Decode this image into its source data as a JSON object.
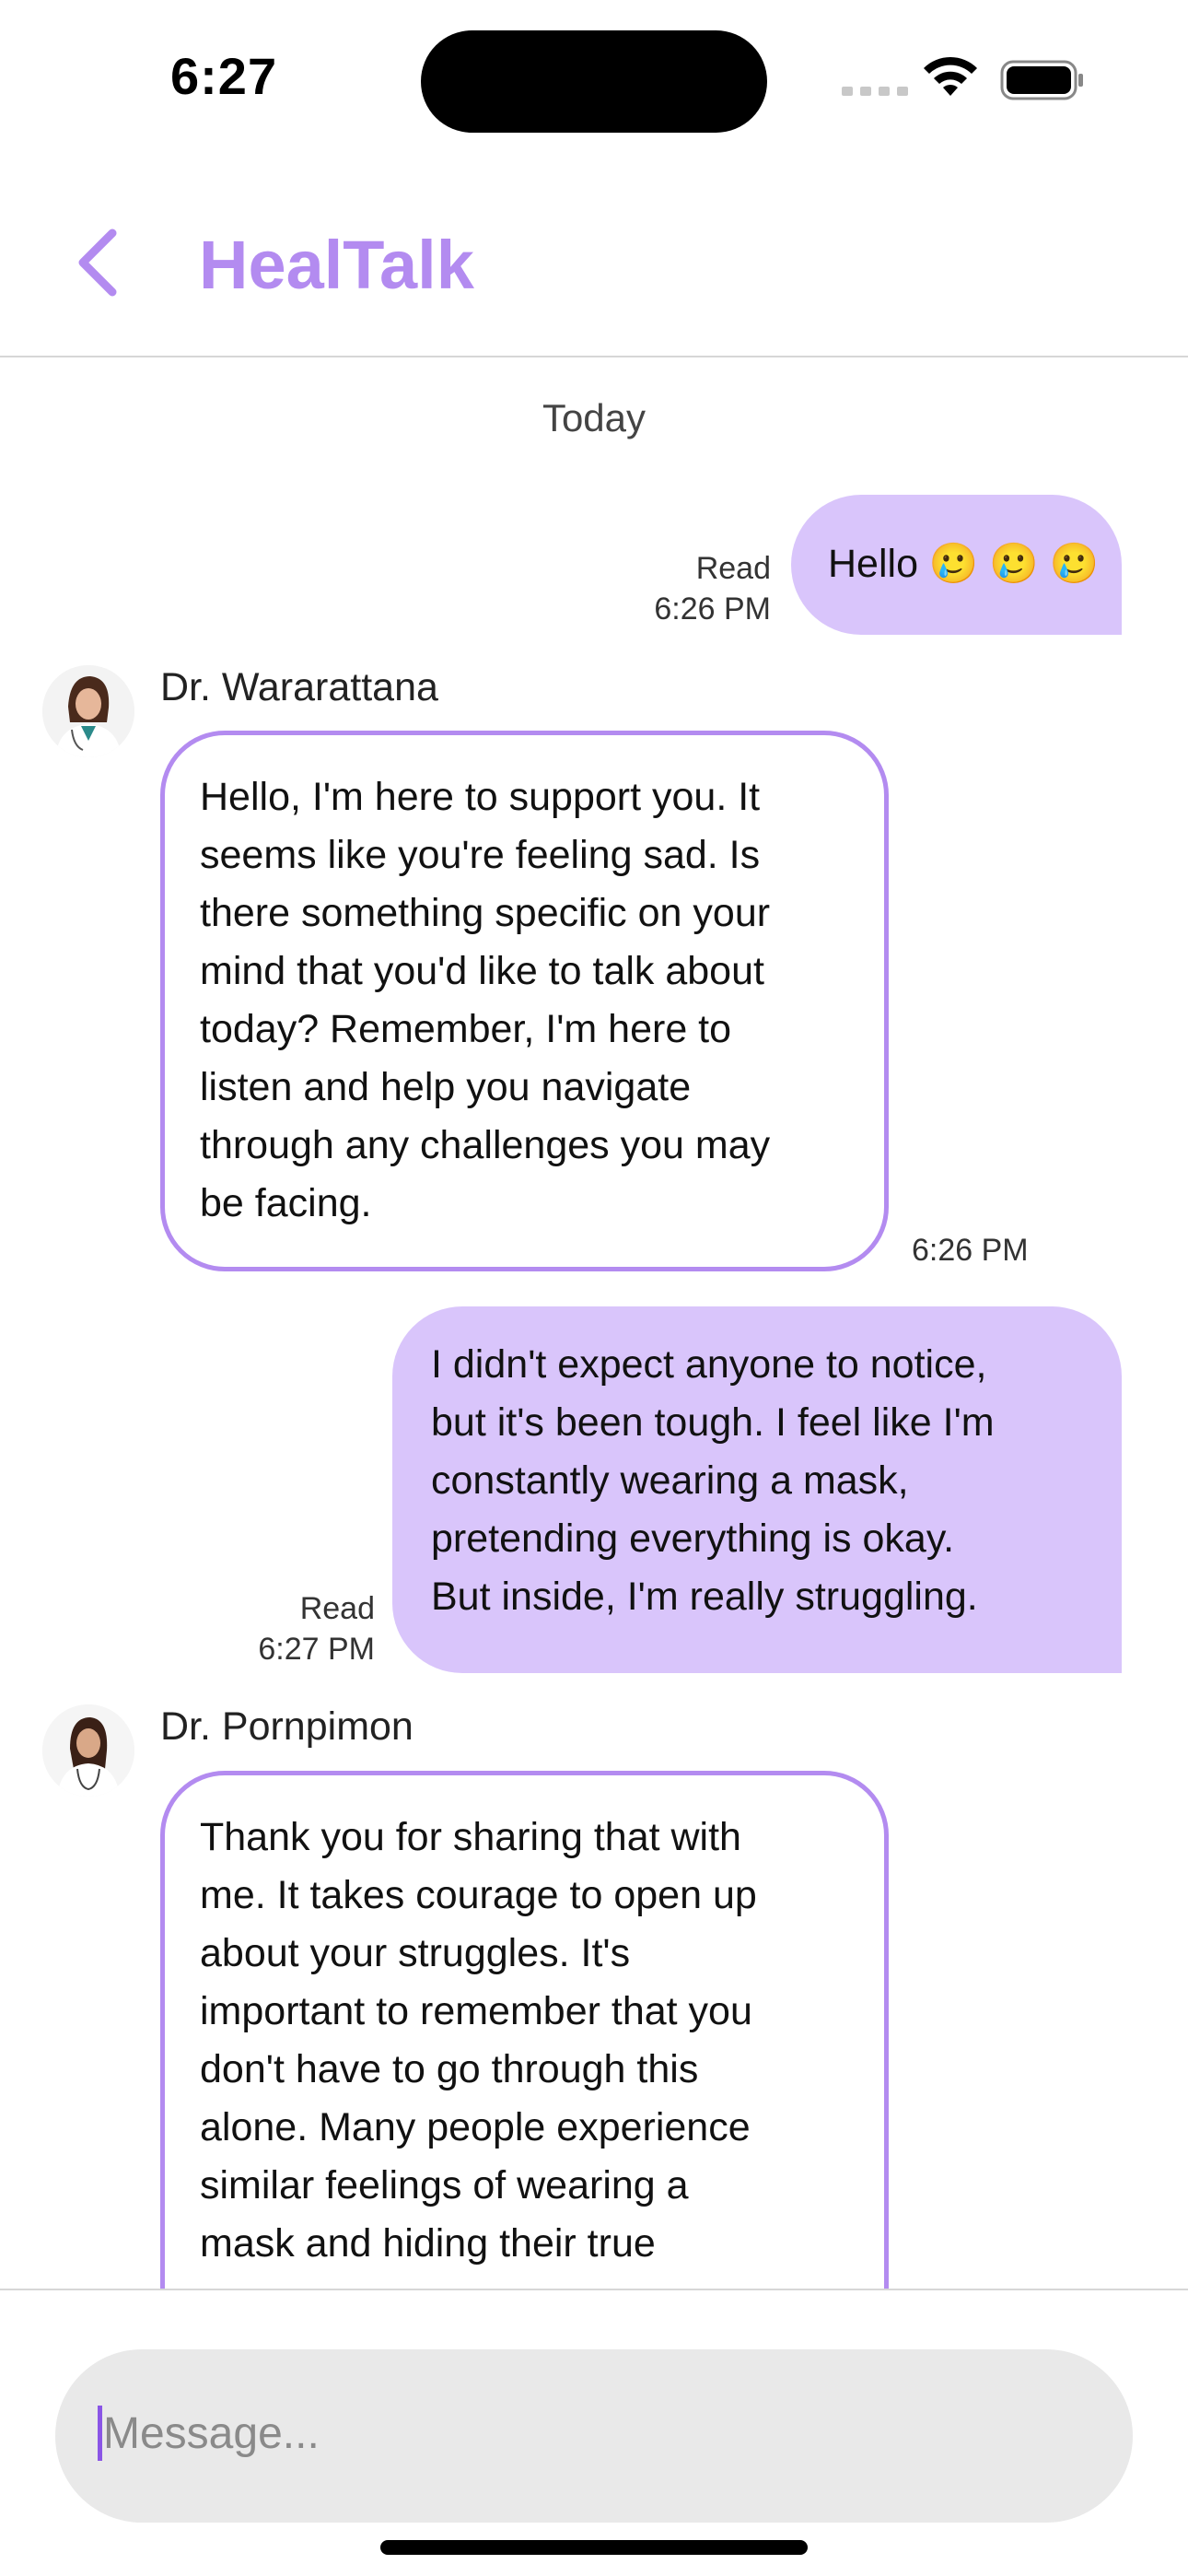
{
  "status_bar": {
    "time": "6:27"
  },
  "header": {
    "title": "HealTalk"
  },
  "chat": {
    "day_separator": "Today",
    "messages": [
      {
        "from": "me",
        "lines": [
          "Hello 🥲 🥲 🥲"
        ],
        "status": "Read",
        "time": "6:26 PM"
      },
      {
        "from": "doctor",
        "sender": "Dr. Wararattana",
        "lines": [
          "Hello, I'm here to support you. It",
          "seems like you're feeling sad. Is",
          "there something specific on your",
          "mind that you'd like to talk about",
          "today? Remember, I'm here to",
          "listen and help you navigate",
          "through any challenges you may",
          "be facing."
        ],
        "time": "6:26 PM"
      },
      {
        "from": "me",
        "lines": [
          "I didn't expect anyone to notice,",
          "but it's been tough. I feel like I'm",
          "constantly wearing a mask,",
          "pretending everything is okay.",
          "But inside, I'm really struggling."
        ],
        "status": "Read",
        "time": "6:27 PM"
      },
      {
        "from": "doctor",
        "sender": "Dr. Pornpimon",
        "lines": [
          "Thank you for sharing that with",
          "me. It takes courage to open up",
          "about your struggles. It's",
          "important to remember that you",
          "don't have to go through this",
          "alone. Many people experience",
          "similar feelings of wearing a",
          "mask and hiding their true"
        ]
      }
    ]
  },
  "composer": {
    "placeholder": "Message..."
  },
  "colors": {
    "accent": "#b38bf0",
    "outgoing_bubble": "#d9c5fb",
    "input_bg": "#e9e9e9"
  },
  "icons": {
    "back": "chevron-left-icon",
    "wifi": "wifi-icon",
    "battery": "battery-icon",
    "signal": "cellular-signal-icon"
  }
}
